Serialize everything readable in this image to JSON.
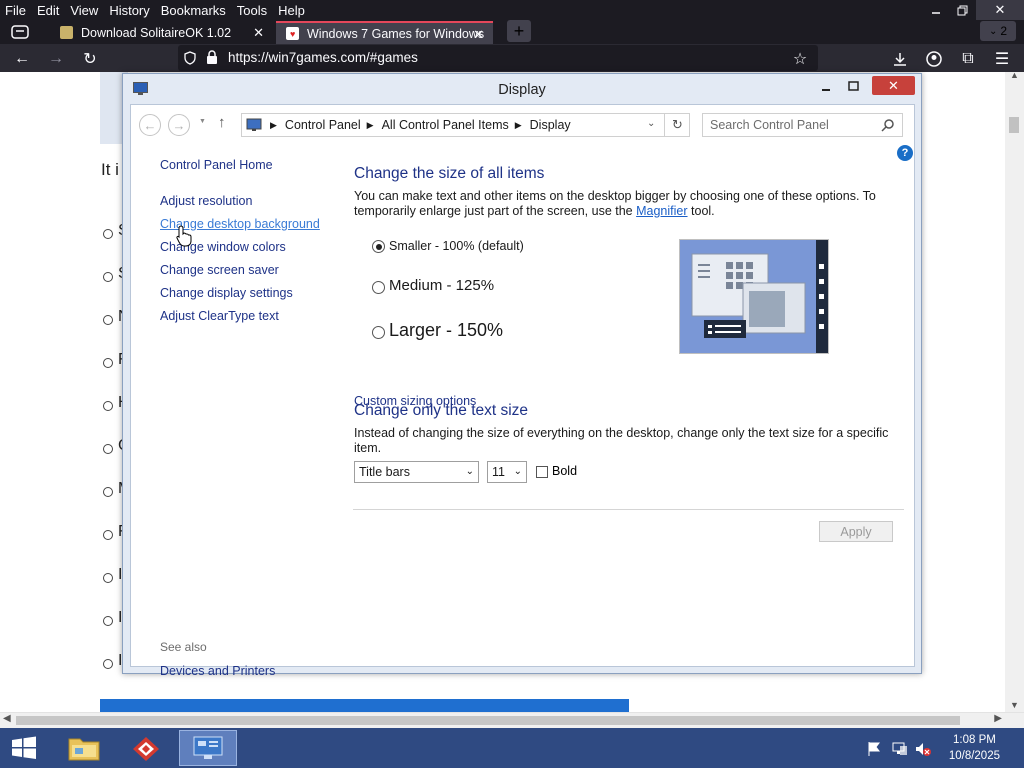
{
  "browser": {
    "menu": [
      "File",
      "Edit",
      "View",
      "History",
      "Bookmarks",
      "Tools",
      "Help"
    ],
    "tabs": [
      {
        "title": "Download SolitaireOK 1.02"
      },
      {
        "title": "Windows 7 Games for Windows"
      }
    ],
    "tab_count_badge": "2",
    "url": "https://win7games.com/#games"
  },
  "page": {
    "text_fragment": "It i",
    "bullet_chars": [
      "S",
      "S",
      "N",
      "F",
      "H",
      "C",
      "M",
      "F",
      "I",
      "I",
      "I"
    ]
  },
  "cpwindow": {
    "title": "Display",
    "breadcrumb": [
      "Control Panel",
      "All Control Panel Items",
      "Display"
    ],
    "search_placeholder": "Search Control Panel",
    "left_nav": {
      "home": "Control Panel Home",
      "links": [
        "Adjust resolution",
        "Change desktop background",
        "Change window colors",
        "Change screen saver",
        "Change display settings",
        "Adjust ClearType text"
      ],
      "see_also_label": "See also",
      "see_also_links": [
        "Devices and Printers"
      ]
    },
    "main": {
      "heading_size": "Change the size of all items",
      "size_desc_before": "You can make text and other items on the desktop bigger by choosing one of these options. To temporarily enlarge just part of the screen, use the",
      "size_desc_link": "Magnifier",
      "size_desc_after": "tool.",
      "options": [
        {
          "label": "Smaller - 100% (default)",
          "selected": true
        },
        {
          "label": "Medium - 125%",
          "selected": false
        },
        {
          "label": "Larger - 150%",
          "selected": false
        }
      ],
      "custom_link": "Custom sizing options",
      "heading_text": "Change only the text size",
      "text_desc": "Instead of changing the size of everything on the desktop, change only the text size for a specific item.",
      "item_select": "Title bars",
      "size_select": "11",
      "bold_label": "Bold",
      "bold_checked": false,
      "apply_label": "Apply"
    }
  },
  "taskbar": {
    "time": "1:08 PM",
    "date": "10/8/2025"
  }
}
